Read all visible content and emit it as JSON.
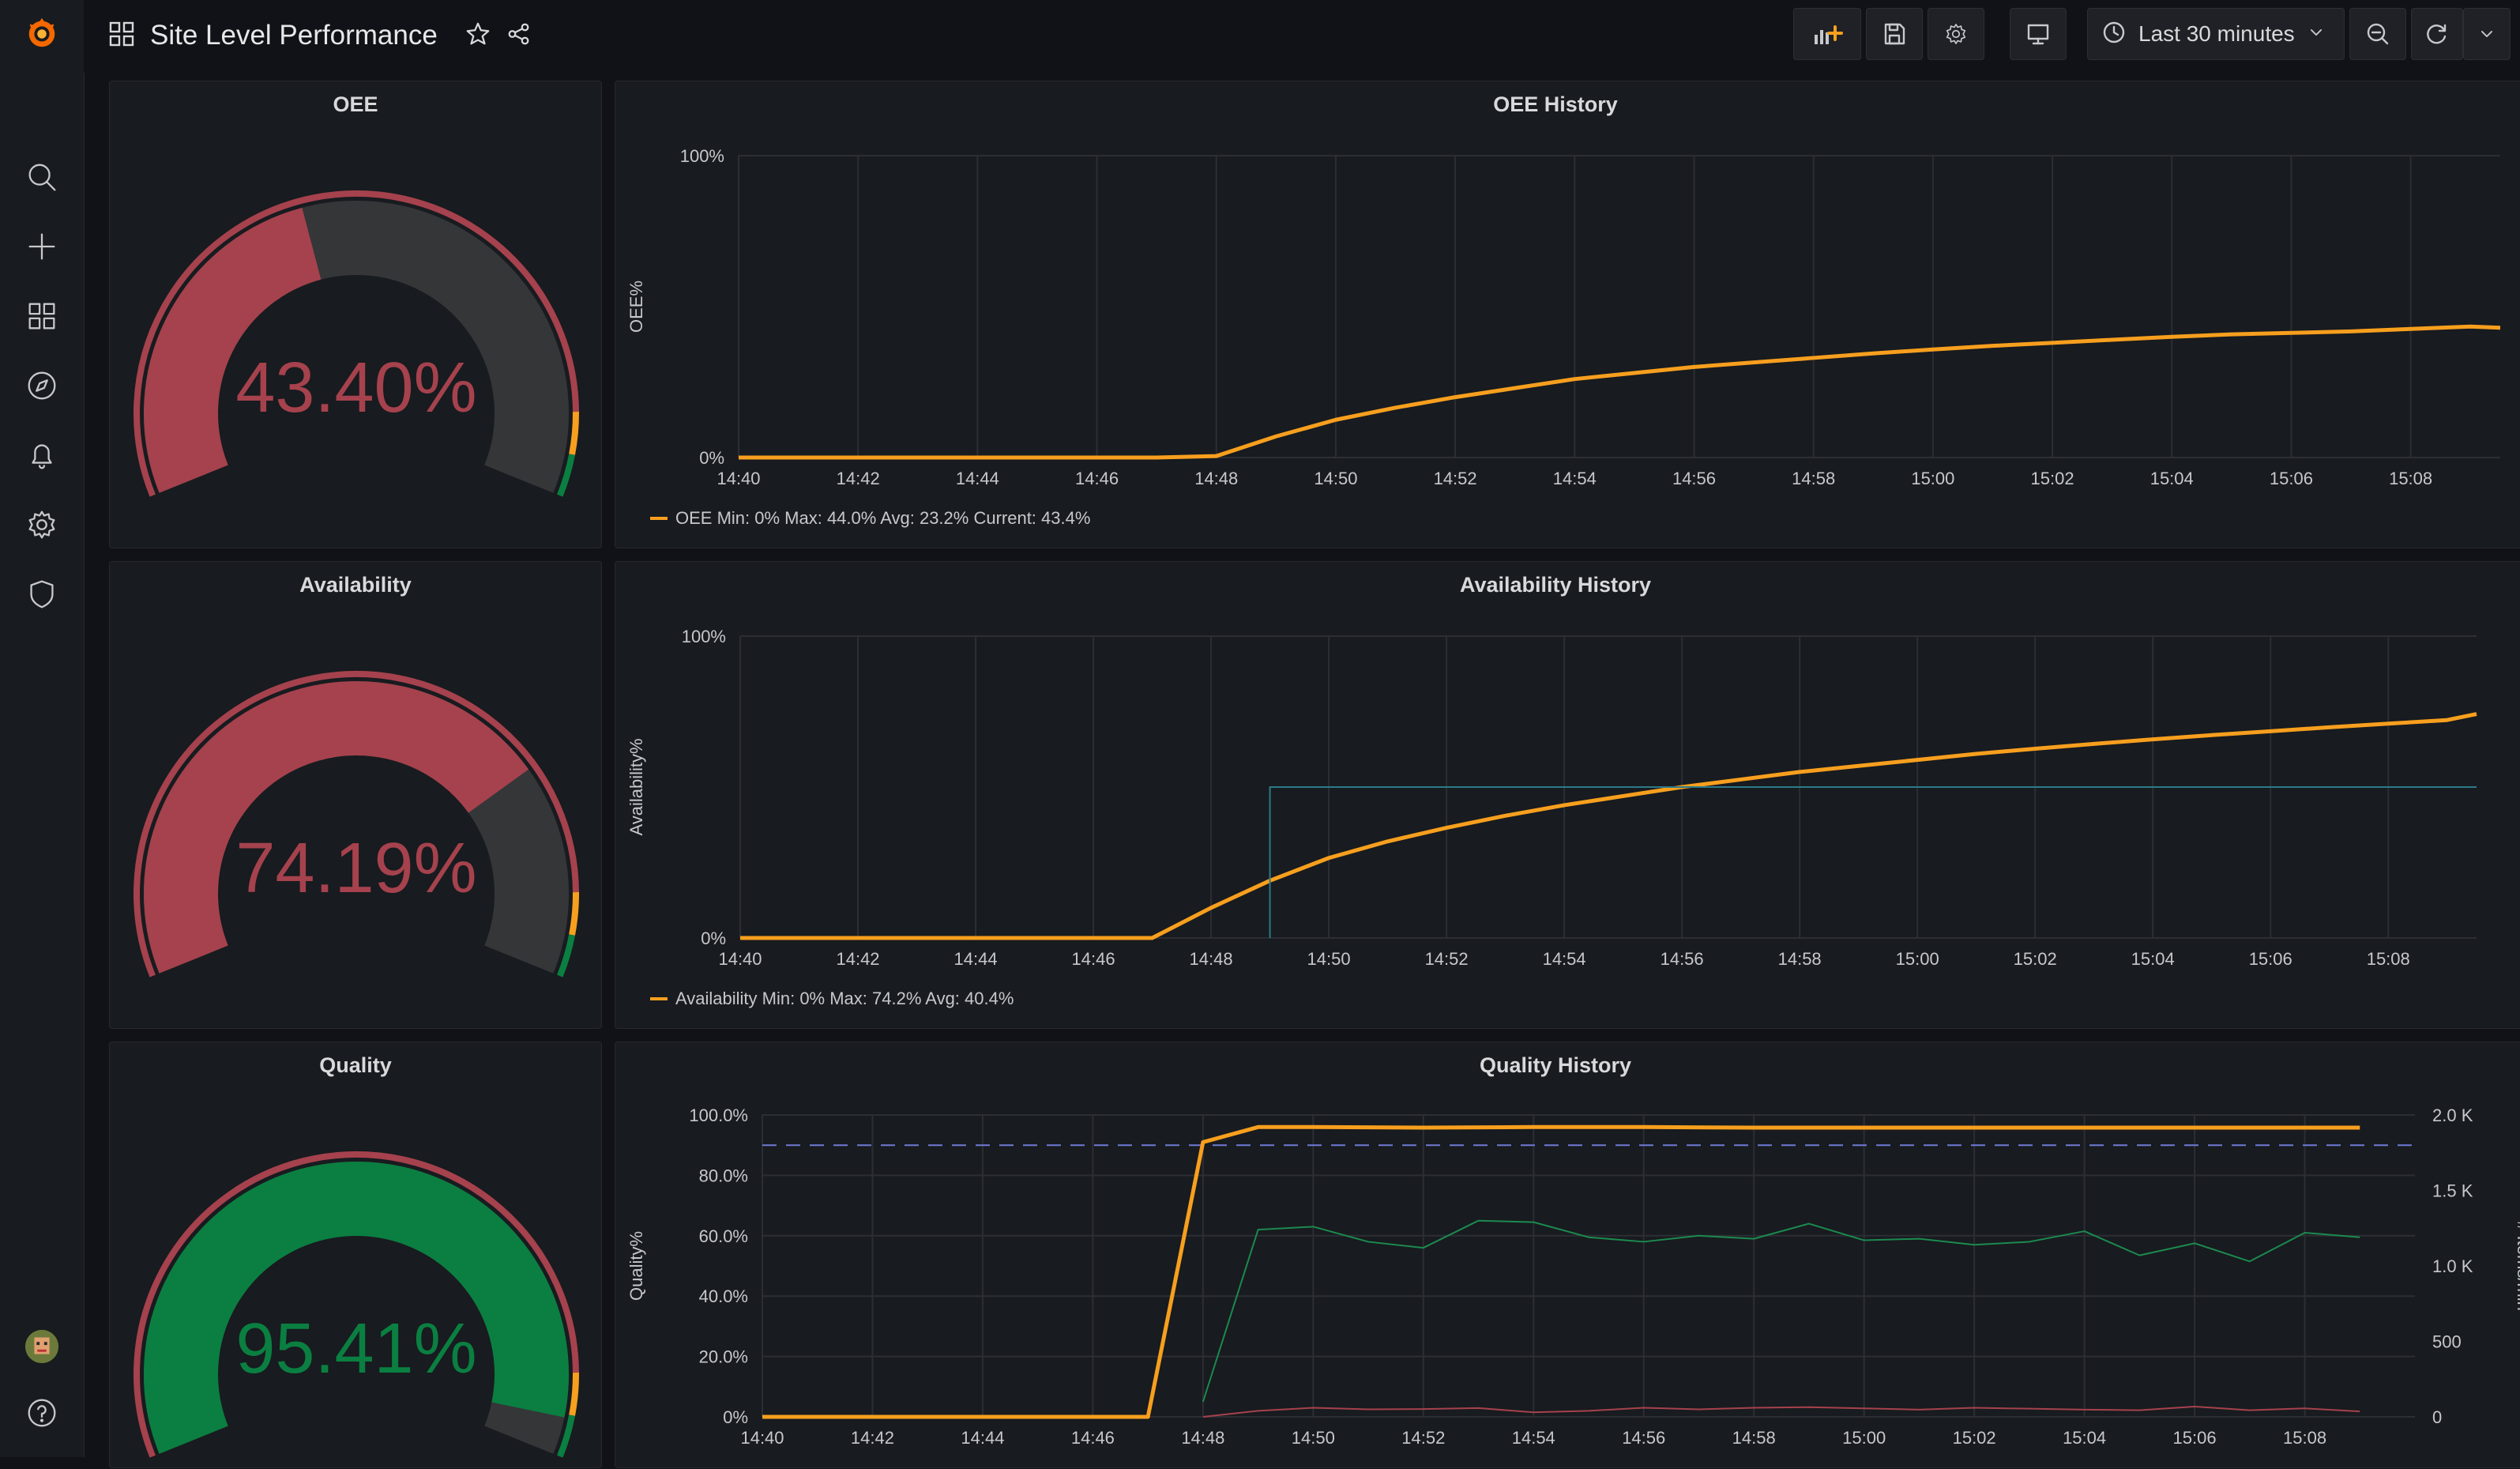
{
  "header": {
    "title": "Site Level Performance",
    "time_range": "Last 30 minutes"
  },
  "colors": {
    "orange": "#f79f1e",
    "red": "#a5424d",
    "green": "#0a7f41",
    "teal": "#2b7a8a",
    "dark": "#353638"
  },
  "panels": {
    "oee": {
      "title": "OEE",
      "value": "43.40%",
      "value_color": "#a5424d",
      "fraction": 0.434
    },
    "availability": {
      "title": "Availability",
      "value": "74.19%",
      "value_color": "#a5424d",
      "fraction": 0.7419
    },
    "quality": {
      "title": "Quality",
      "value": "95.41%",
      "value_color": "#0a7f41",
      "fraction": 0.9541
    },
    "oee_history": {
      "title": "OEE History",
      "legend": "OEE  Min: 0%  Max: 44.0%  Avg: 23.2%  Current: 43.4%"
    },
    "availability_history": {
      "title": "Availability History",
      "legend": "Availability  Min: 0%  Max: 74.2%  Avg: 40.4%"
    },
    "quality_history": {
      "title": "Quality History"
    }
  },
  "chart_data": [
    {
      "type": "line",
      "title": "OEE History",
      "ylabel": "OEE%",
      "ylim": [
        0,
        100
      ],
      "y_ticks": [
        "0%",
        "100%"
      ],
      "x_ticks": [
        "14:40",
        "14:42",
        "14:44",
        "14:46",
        "14:48",
        "14:50",
        "14:52",
        "14:54",
        "14:56",
        "14:58",
        "15:00",
        "15:02",
        "15:04",
        "15:06",
        "15:08"
      ],
      "series": [
        {
          "name": "OEE",
          "color": "#f79f1e",
          "x": [
            "14:40",
            "14:42",
            "14:44",
            "14:46",
            "14:47",
            "14:48",
            "14:49",
            "14:50",
            "14:51",
            "14:52",
            "14:53",
            "14:54",
            "14:55",
            "14:56",
            "14:57",
            "14:58",
            "14:59",
            "15:00",
            "15:01",
            "15:02",
            "15:03",
            "15:04",
            "15:05",
            "15:06",
            "15:07",
            "15:08",
            "15:09",
            "15:09.5"
          ],
          "values": [
            0,
            0,
            0,
            0,
            0,
            0.5,
            7,
            12.5,
            16.5,
            20,
            23,
            26,
            28,
            30,
            31.5,
            33,
            34.5,
            35.8,
            37,
            38,
            39,
            40,
            40.8,
            41.3,
            41.8,
            42.6,
            43.4,
            43.0
          ]
        }
      ],
      "legend": "bottom-left",
      "grid": true
    },
    {
      "type": "line",
      "title": "Availability History",
      "ylabel": "Availability%",
      "ylim": [
        0,
        100
      ],
      "y_ticks": [
        "0%",
        "100%"
      ],
      "x_ticks": [
        "14:40",
        "14:42",
        "14:44",
        "14:46",
        "14:48",
        "14:50",
        "14:52",
        "14:54",
        "14:56",
        "14:58",
        "15:00",
        "15:02",
        "15:04",
        "15:06",
        "15:08"
      ],
      "series": [
        {
          "name": "Availability",
          "color": "#f79f1e",
          "x": [
            "14:40",
            "14:42",
            "14:44",
            "14:46",
            "14:47",
            "14:48",
            "14:49",
            "14:50",
            "14:51",
            "14:52",
            "14:53",
            "14:54",
            "14:55",
            "14:56",
            "14:57",
            "14:58",
            "14:59",
            "15:00",
            "15:01",
            "15:02",
            "15:03",
            "15:04",
            "15:05",
            "15:06",
            "15:07",
            "15:08",
            "15:09",
            "15:09.5"
          ],
          "values": [
            0,
            0,
            0,
            0,
            0,
            10,
            19,
            26.5,
            32,
            36.5,
            40.5,
            44,
            47,
            50,
            52.5,
            55,
            57,
            59,
            61,
            62.7,
            64.3,
            65.8,
            67.2,
            68.5,
            69.8,
            71,
            72.2,
            74.2
          ]
        },
        {
          "name": "",
          "color": "#2b7a8a",
          "x": [
            "14:49",
            "14:49",
            "15:09.5"
          ],
          "values": [
            0,
            50,
            50
          ]
        }
      ],
      "legend": "bottom-left",
      "grid": true
    },
    {
      "type": "line",
      "title": "Quality History",
      "ylabel": "Quality%",
      "y2label": "# Items/min",
      "ylim": [
        0,
        100
      ],
      "y_ticks": [
        "0%",
        "20.0%",
        "40.0%",
        "60.0%",
        "80.0%",
        "100.0%"
      ],
      "y2_ticks": [
        "0",
        "500",
        "1.0 K",
        "1.5 K",
        "2.0 K"
      ],
      "x_ticks": [
        "14:40",
        "14:42",
        "14:44",
        "14:46",
        "14:48",
        "14:50",
        "14:52",
        "14:54",
        "14:56",
        "14:58",
        "15:00",
        "15:02",
        "15:04",
        "15:06",
        "15:08"
      ],
      "threshold": 90,
      "series": [
        {
          "name": "",
          "color": "#f79f1e",
          "x": [
            "14:40",
            "14:42",
            "14:44",
            "14:46",
            "14:47",
            "14:48",
            "14:49",
            "14:50",
            "14:52",
            "14:54",
            "14:56",
            "14:58",
            "15:00",
            "15:02",
            "15:04",
            "15:06",
            "15:08",
            "15:09"
          ],
          "values": [
            0,
            0,
            0,
            0,
            0,
            91,
            96,
            96,
            95.8,
            96,
            96,
            95.8,
            95.8,
            95.8,
            95.8,
            95.8,
            95.8,
            95.8
          ]
        },
        {
          "name": "",
          "color": "#1b8a4f",
          "x": [
            "14:48",
            "14:49",
            "14:50",
            "14:51",
            "14:52",
            "14:53",
            "14:54",
            "14:55",
            "14:56",
            "14:57",
            "14:58",
            "14:59",
            "15:00",
            "15:01",
            "15:02",
            "15:03",
            "15:04",
            "15:05",
            "15:06",
            "15:07",
            "15:08",
            "15:09"
          ],
          "values": [
            5,
            62,
            63,
            58,
            56,
            65,
            64.5,
            59.5,
            58,
            60,
            59,
            64,
            58.5,
            59,
            57,
            58,
            61.5,
            53.5,
            57.5,
            51.5,
            61,
            59.5
          ]
        },
        {
          "name": "",
          "color": "#a5424d",
          "x": [
            "14:48",
            "14:49",
            "14:50",
            "14:51",
            "14:52",
            "14:53",
            "14:54",
            "14:55",
            "14:56",
            "14:57",
            "14:58",
            "14:59",
            "15:00",
            "15:01",
            "15:02",
            "15:03",
            "15:04",
            "15:05",
            "15:06",
            "15:07",
            "15:08",
            "15:09"
          ],
          "values": [
            0,
            2,
            3,
            2.5,
            2.6,
            2.9,
            1.5,
            2,
            3,
            2.5,
            3,
            3.2,
            2.8,
            2.4,
            3,
            2.7,
            2.4,
            2.2,
            3.4,
            2.2,
            2.8,
            1.8
          ]
        }
      ],
      "grid": true
    }
  ]
}
